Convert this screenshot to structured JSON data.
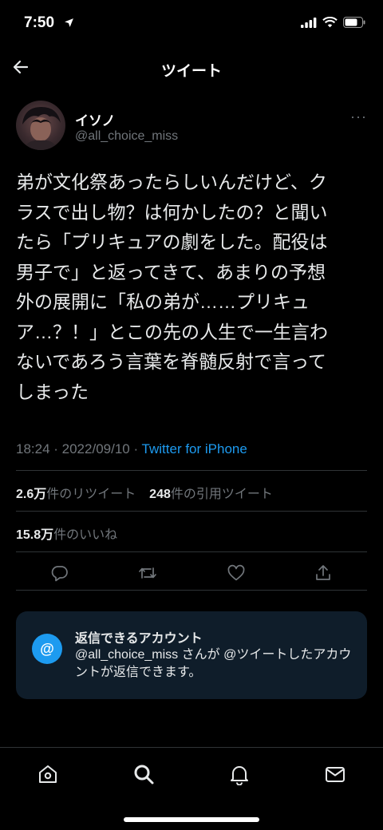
{
  "status_bar": {
    "time": "7:50"
  },
  "nav": {
    "title": "ツイート"
  },
  "author": {
    "display_name": "イソノ",
    "handle": "@all_choice_miss",
    "more": "···"
  },
  "tweet": {
    "text": "弟が文化祭あったらしいんだけど、ク\nラスで出し物？は何かしたの？と聞い\nたら「プリキュアの劇をした。配役は\n男子で」と返ってきて、あまりの予想\n外の展開に「私の弟が……プリキュ\nア…？！」とこの先の人生で一生言わ\nないであろう言葉を脊髄反射で言って\nしまった",
    "timestamp": "18:24 · 2022/09/10 · ",
    "source": "Twitter for iPhone"
  },
  "stats": {
    "retweets_count": "2.6万",
    "retweets_label": "件のリツイート",
    "quotes_count": "248",
    "quotes_label": "件の引用ツイート",
    "likes_count": "15.8万",
    "likes_label": "件のいいね"
  },
  "reply_card": {
    "icon_text": "@",
    "title": "返信できるアカウント",
    "body": "@all_choice_miss さんが @ツイートしたアカウントが返信できます。"
  },
  "icons": {
    "back": "arrow-left-icon",
    "reply": "reply-icon",
    "retweet": "retweet-icon",
    "like": "heart-icon",
    "share": "share-icon",
    "home": "home-icon",
    "search": "search-icon",
    "notifications": "bell-icon",
    "messages": "mail-icon"
  },
  "colors": {
    "accent": "#1d9bf0",
    "card_bg": "#0f1d2a",
    "muted": "#71767b"
  }
}
